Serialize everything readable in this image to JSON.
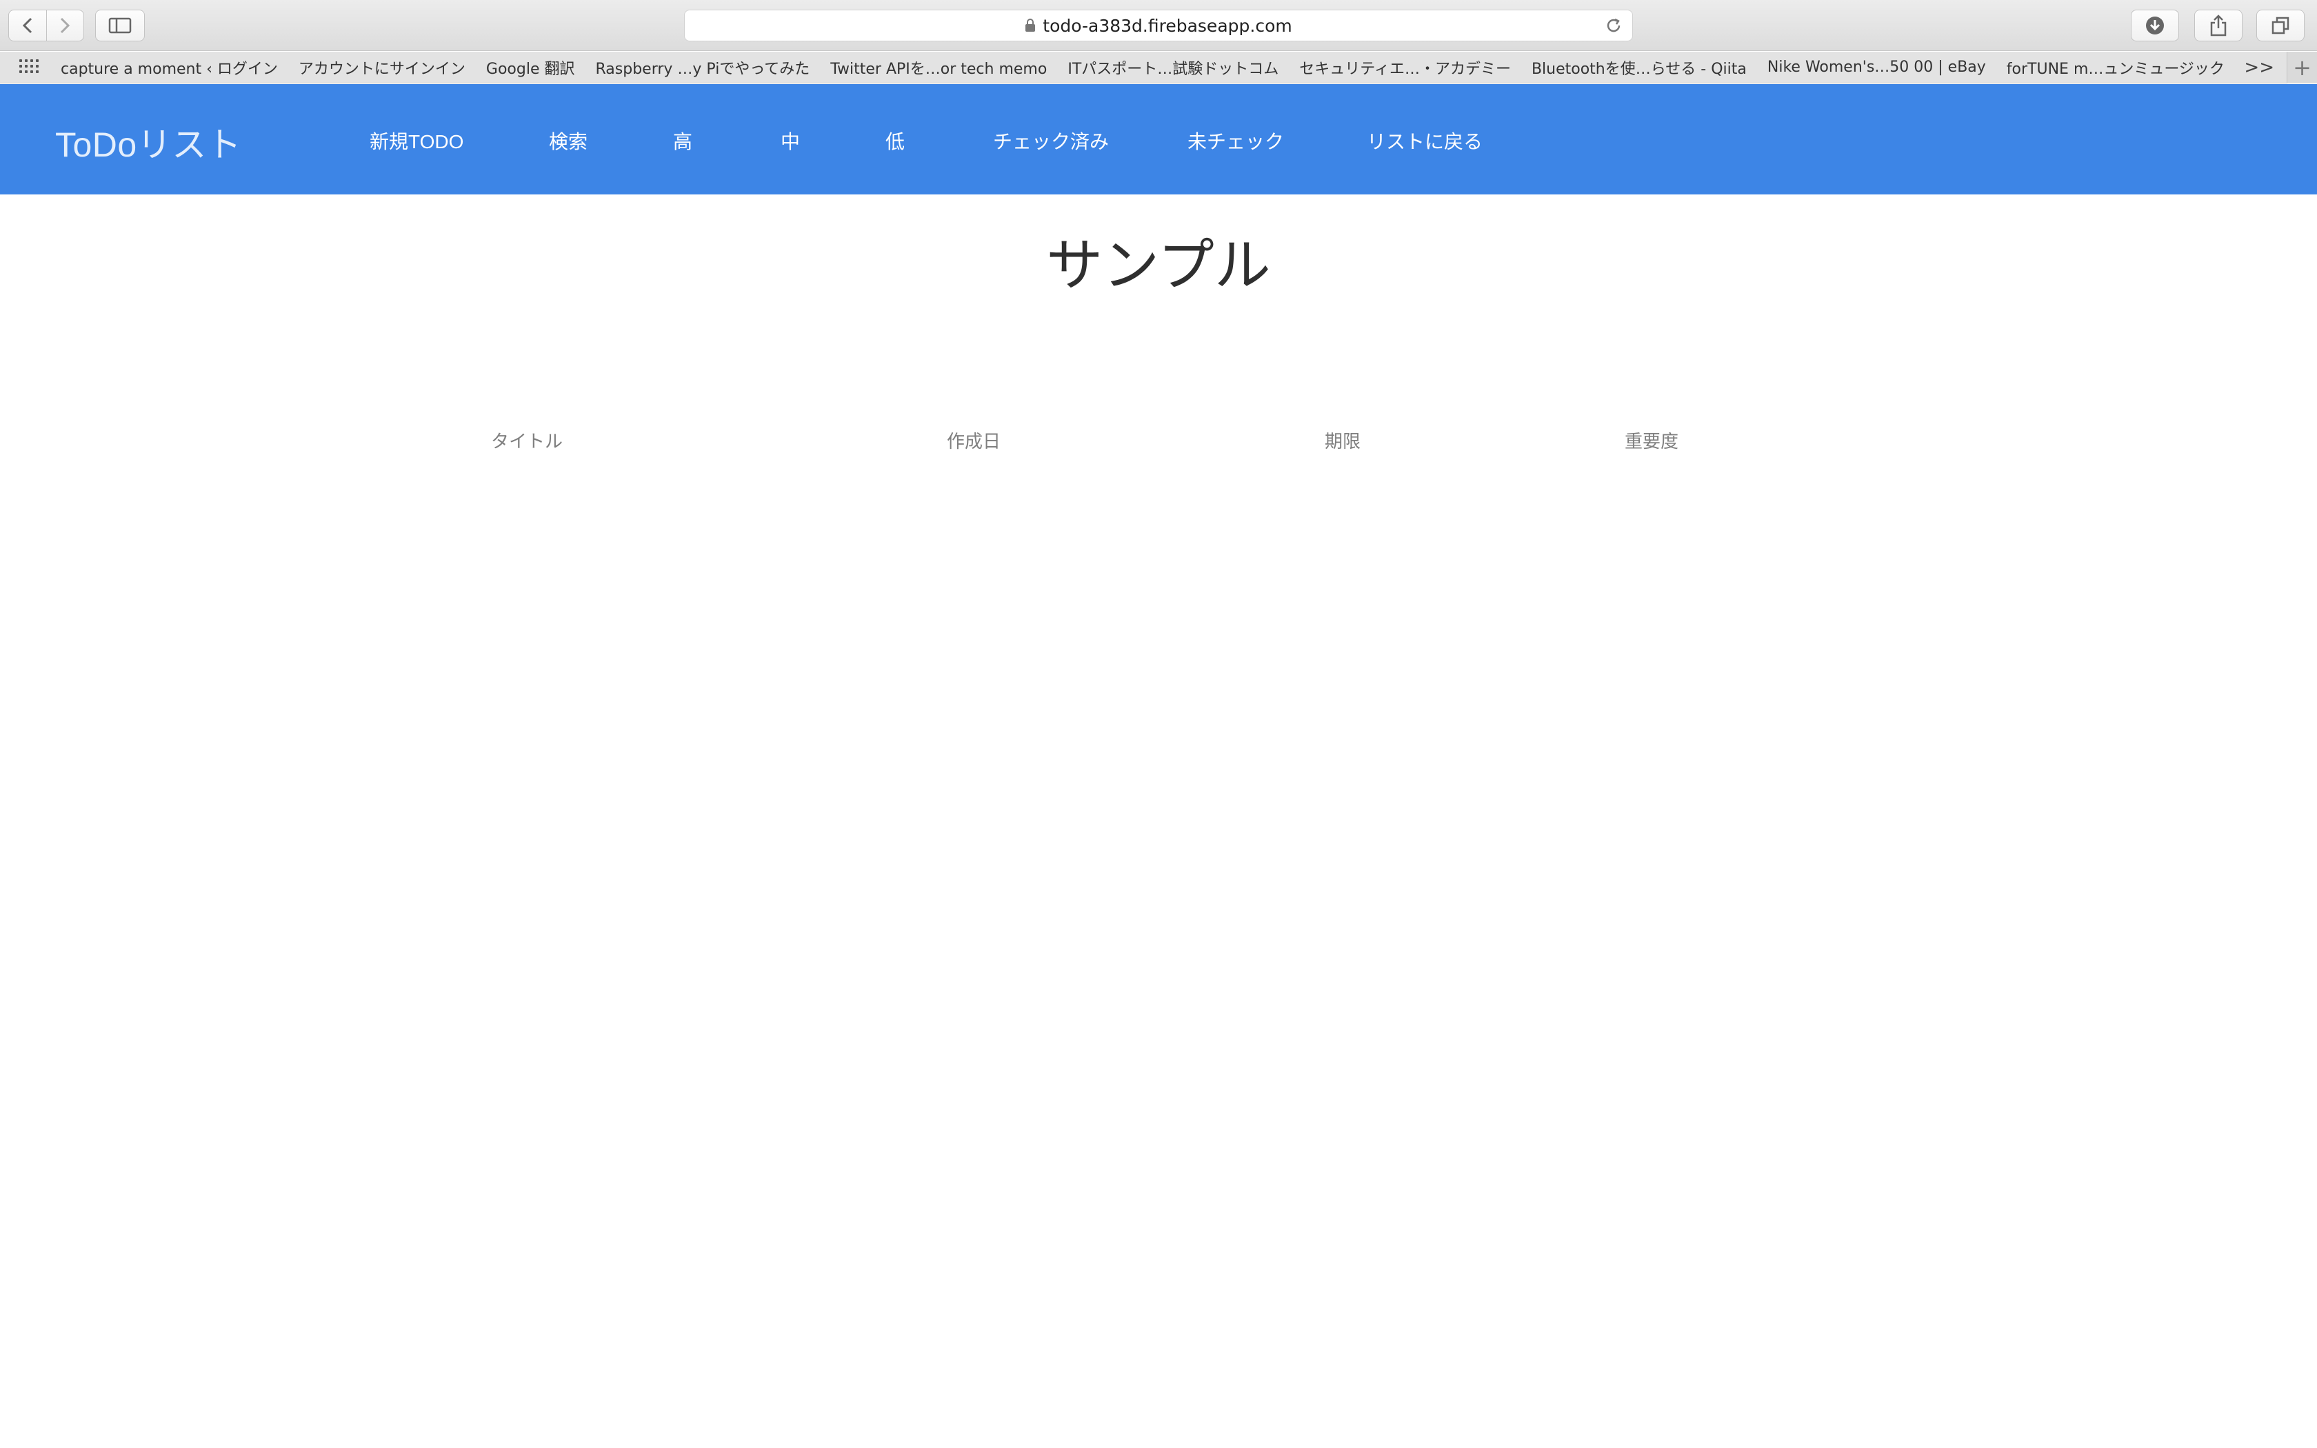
{
  "browser": {
    "url": "todo-a383d.firebaseapp.com",
    "bookmarks": [
      "capture a moment ‹ ログイン",
      "アカウントにサインイン",
      "Google 翻訳",
      "Raspberry …y Piでやってみた",
      "Twitter APIを…or tech memo",
      "ITパスポート…試験ドットコム",
      "セキュリティエ…・アカデミー",
      "Bluetoothを使…らせる - Qiita",
      "Nike Women's…50 00 | eBay",
      "forTUNE m…ュンミュージック"
    ],
    "more_label": ">>",
    "new_tab_label": "+"
  },
  "app": {
    "brand": "ToDoリスト",
    "nav": [
      "新規TODO",
      "検索",
      "高",
      "中",
      "低",
      "チェック済み",
      "未チェック",
      "リストに戻る"
    ]
  },
  "main": {
    "title": "サンプル",
    "columns": [
      "タイトル",
      "作成日",
      "期限",
      "重要度"
    ]
  },
  "colors": {
    "navbar": "#3d85e6",
    "brand_text": "#e3eefc",
    "nav_text": "#ffffff"
  }
}
